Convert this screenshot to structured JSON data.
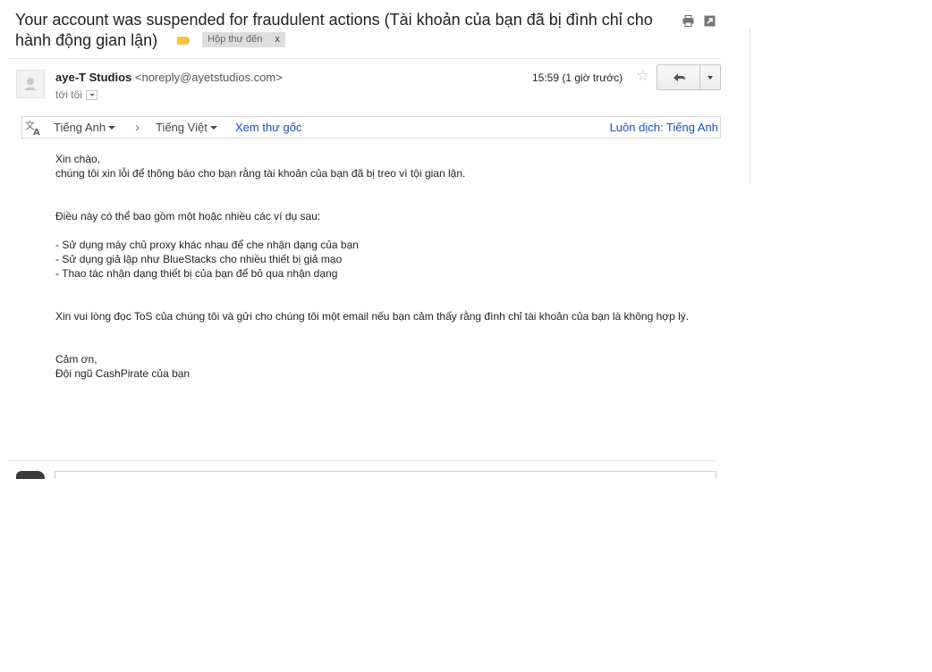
{
  "email": {
    "subject": "Your account was suspended for fraudulent actions (Tài khoản của bạn đã bị đình chỉ cho hành động gian lận)",
    "label_chip": "Hộp thư đến",
    "label_chip_remove": "x",
    "sender_name": "aye-T Studios",
    "sender_email": "<noreply@ayetstudios.com>",
    "recipient": "tới tôi",
    "time": "15:59 (1 giờ trước)",
    "star": "☆"
  },
  "translate_bar": {
    "source_language": "Tiếng Anh",
    "separator": "›",
    "target_language": "Tiếng Việt",
    "view_original": "Xem thư gốc",
    "always_translate": "Luôn dịch: Tiếng Anh"
  },
  "body": {
    "greeting": "Xin chào,\nchúng tôi xin lỗi để thông báo cho bạn rằng tài khoản của bạn đã bị treo vì tội gian lận.",
    "examples_intro": "Điều này có thể bao gồm một hoặc nhiều các ví dụ sau:",
    "examples": "- Sử dụng máy chủ proxy khác nhau để che nhận dạng của bạn\n- Sử dụng giả lập như BlueStacks cho nhiều thiết bị giả mạo\n- Thao tác nhận dạng thiết bị của bạn để bỏ qua nhận dạng",
    "request": "Xin vui lòng đọc ToS của chúng tôi và gửi cho chúng tôi một email nếu bạn cảm thấy rằng đình chỉ tài khoản của bạn là không hợp lý.",
    "signoff": "Cảm ơn,\nĐội ngũ CashPirate của bạn"
  },
  "colors": {
    "link": "#1a4fb6",
    "label": "#f5c543",
    "chip_bg": "#dddddd"
  }
}
